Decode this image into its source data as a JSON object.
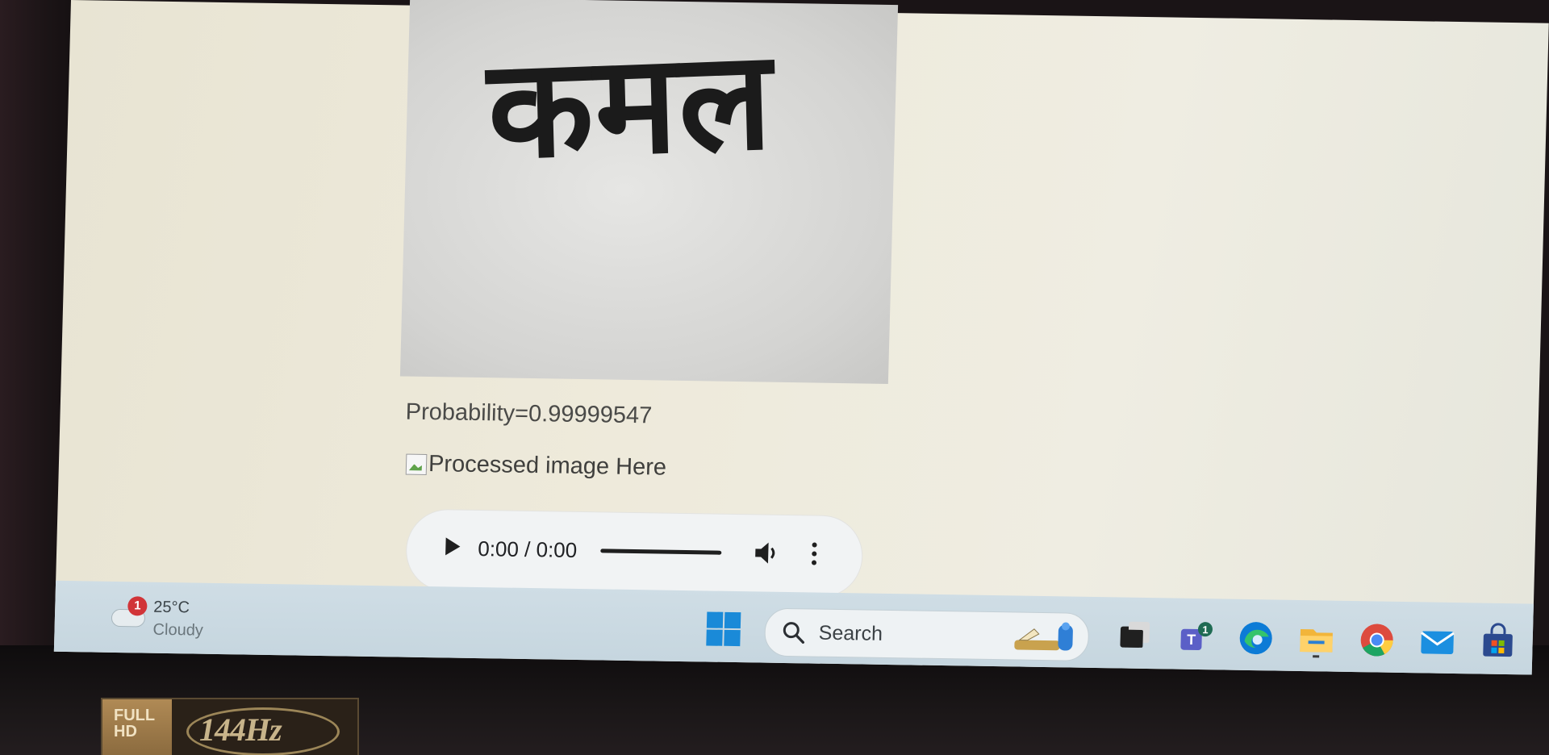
{
  "page": {
    "handwritten_word": "कमल",
    "probability": "Probability=0.99999547",
    "processed_image_alt": "Processed image Here"
  },
  "audio_player": {
    "time": "0:00 / 0:00"
  },
  "taskbar": {
    "weather": {
      "badge": "1",
      "temperature": "25°C",
      "condition": "Cloudy"
    },
    "search_label": "Search",
    "teams_badge": "1",
    "apps": [
      "task-view-icon",
      "teams-icon",
      "edge-icon",
      "file-explorer-icon",
      "chrome-icon",
      "mail-icon",
      "store-icon"
    ]
  },
  "monitor_sticker": {
    "resolution": "FULL HD",
    "refresh": "144Hz"
  },
  "colors": {
    "accent": "#1a8ad8",
    "badge": "#d13438"
  }
}
